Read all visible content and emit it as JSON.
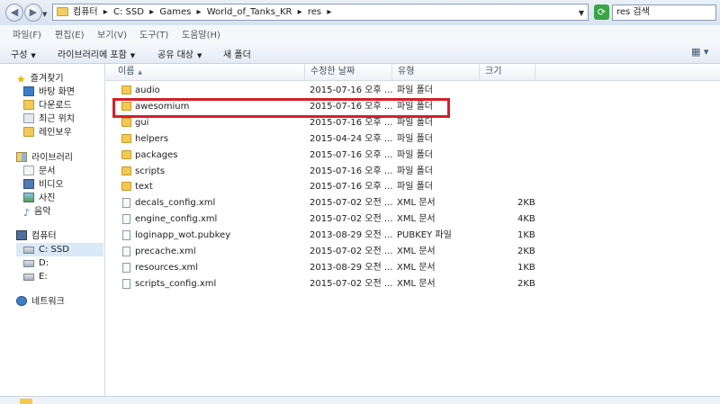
{
  "address": {
    "crumbs": [
      "컴퓨터",
      "▸",
      "C: SSD",
      "▸",
      "Games",
      "▸",
      "World_of_Tanks_KR",
      "▸",
      "res",
      "▸"
    ],
    "search_placeholder": "res 검색"
  },
  "menu": [
    "파일(F)",
    "편집(E)",
    "보기(V)",
    "도구(T)",
    "도움말(H)"
  ],
  "toolbar": {
    "organize": "구성",
    "include_library": "라이브러리에 포함",
    "share_with": "공유 대상",
    "new_folder": "새 폴더"
  },
  "nav": {
    "favorites": "즐겨찾기",
    "desktop": "바탕 화면",
    "downloads": "다운로드",
    "recent": "최근 위치",
    "rainbow": "레인보우",
    "libraries": "라이브러리",
    "documents": "문서",
    "videos": "비디오",
    "pictures": "사진",
    "music": "음악",
    "computer": "컴퓨터",
    "drive_c": "C: SSD",
    "drive_d": "D:",
    "drive_e": "E:",
    "network": "네트워크"
  },
  "columns": {
    "name": "이름",
    "date": "수정한 날짜",
    "type": "유형",
    "size": "크기"
  },
  "files": [
    {
      "name": "audio",
      "date": "2015-07-16 오후 ...",
      "type": "파일 폴더",
      "size": "",
      "kind": "folder"
    },
    {
      "name": "awesomium",
      "date": "2015-07-16 오후 ...",
      "type": "파일 폴더",
      "size": "",
      "kind": "folder"
    },
    {
      "name": "gui",
      "date": "2015-07-16 오후 ...",
      "type": "파일 폴더",
      "size": "",
      "kind": "folder"
    },
    {
      "name": "helpers",
      "date": "2015-04-24 오후 ...",
      "type": "파일 폴더",
      "size": "",
      "kind": "folder"
    },
    {
      "name": "packages",
      "date": "2015-07-16 오후 ...",
      "type": "파일 폴더",
      "size": "",
      "kind": "folder"
    },
    {
      "name": "scripts",
      "date": "2015-07-16 오후 ...",
      "type": "파일 폴더",
      "size": "",
      "kind": "folder"
    },
    {
      "name": "text",
      "date": "2015-07-16 오후 ...",
      "type": "파일 폴더",
      "size": "",
      "kind": "folder"
    },
    {
      "name": "decals_config.xml",
      "date": "2015-07-02 오전 ...",
      "type": "XML 문서",
      "size": "2KB",
      "kind": "xml"
    },
    {
      "name": "engine_config.xml",
      "date": "2015-07-02 오전 ...",
      "type": "XML 문서",
      "size": "4KB",
      "kind": "xml"
    },
    {
      "name": "loginapp_wot.pubkey",
      "date": "2013-08-29 오전 ...",
      "type": "PUBKEY 파일",
      "size": "1KB",
      "kind": "file"
    },
    {
      "name": "precache.xml",
      "date": "2015-07-02 오전 ...",
      "type": "XML 문서",
      "size": "2KB",
      "kind": "xml"
    },
    {
      "name": "resources.xml",
      "date": "2013-08-29 오전 ...",
      "type": "XML 문서",
      "size": "1KB",
      "kind": "xml"
    },
    {
      "name": "scripts_config.xml",
      "date": "2015-07-02 오전 ...",
      "type": "XML 문서",
      "size": "2KB",
      "kind": "xml"
    }
  ],
  "highlighted_item": "awesomium",
  "colors": {
    "highlight_border": "#d3202b",
    "folder": "#f2c955",
    "selection": "#dbe8f7"
  }
}
